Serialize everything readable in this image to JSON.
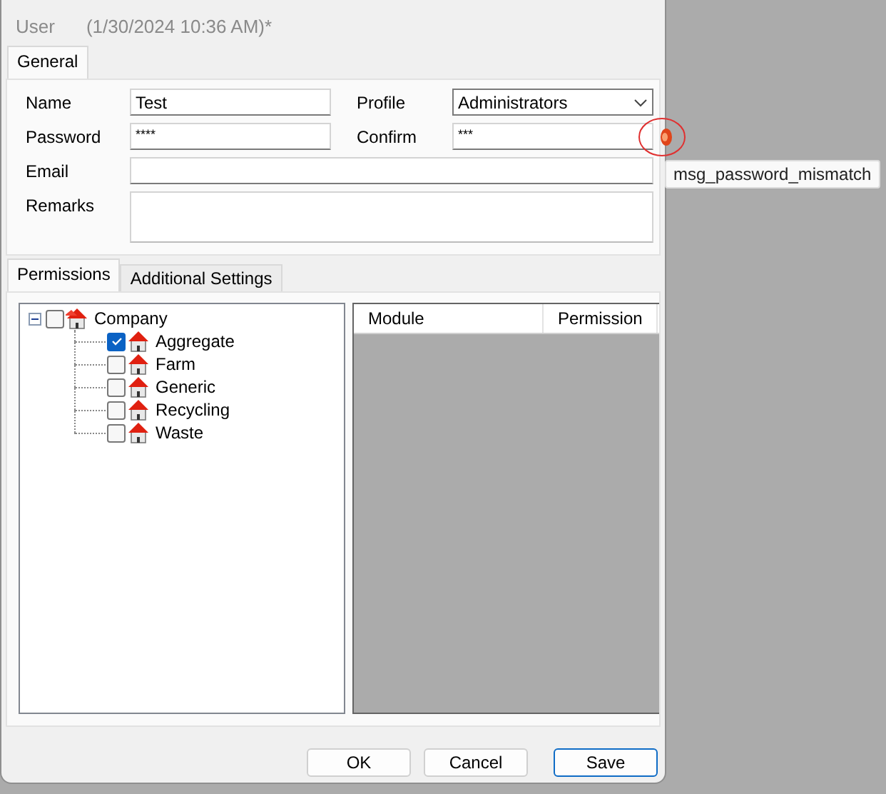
{
  "window": {
    "title": "User",
    "subtitle": "(1/30/2024 10:36 AM)*"
  },
  "top_tabs": [
    {
      "label": "General",
      "selected": true
    }
  ],
  "form": {
    "name": {
      "label": "Name",
      "value": "Test"
    },
    "password": {
      "label": "Password",
      "value": "****"
    },
    "profile": {
      "label": "Profile",
      "value": "Administrators"
    },
    "confirm": {
      "label": "Confirm",
      "value": "***",
      "error": true
    },
    "email": {
      "label": "Email"
    },
    "remarks": {
      "label": "Remarks"
    }
  },
  "tooltip": "msg_password_mismatch",
  "bottom_tabs": [
    {
      "label": "Permissions",
      "selected": true
    },
    {
      "label": "Additional Settings",
      "selected": false
    }
  ],
  "tree": [
    {
      "label": "Company",
      "checked": false,
      "expanded": true,
      "children": [
        {
          "label": "Aggregate",
          "checked": true
        },
        {
          "label": "Farm",
          "checked": false
        },
        {
          "label": "Generic",
          "checked": false
        },
        {
          "label": "Recycling",
          "checked": false
        },
        {
          "label": "Waste",
          "checked": false
        }
      ]
    }
  ],
  "grid": {
    "columns": [
      "Module",
      "Permission"
    ]
  },
  "buttons": [
    {
      "label": "OK",
      "default": false
    },
    {
      "label": "Cancel",
      "default": false
    },
    {
      "label": "Save",
      "default": true
    }
  ]
}
